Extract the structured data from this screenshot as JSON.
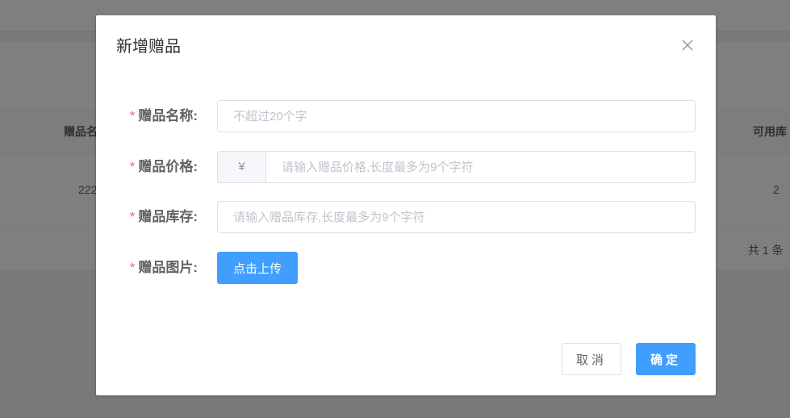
{
  "background": {
    "table": {
      "headers": [
        "赠品名",
        "可用库"
      ],
      "row": [
        "222",
        "2"
      ],
      "total": "共 1 条"
    }
  },
  "dialog": {
    "title": "新增赠品",
    "close_icon": "close-icon",
    "fields": {
      "name": {
        "required_mark": "*",
        "label": "赠品名称:",
        "value": "",
        "placeholder": "不超过20个字"
      },
      "price": {
        "required_mark": "*",
        "label": "赠品价格:",
        "prefix": "¥",
        "value": "",
        "placeholder": "请输入赠品价格,长度最多为9个字符"
      },
      "stock": {
        "required_mark": "*",
        "label": "赠品库存:",
        "value": "",
        "placeholder": "请输入赠品库存,长度最多为9个字符"
      },
      "image": {
        "required_mark": "*",
        "label": "赠品图片:",
        "upload_label": "点击上传"
      }
    },
    "footer": {
      "cancel_label": "取消",
      "confirm_label": "确定"
    }
  },
  "colors": {
    "primary": "#409eff",
    "required": "#f56c6c",
    "border": "#dcdfe6"
  }
}
